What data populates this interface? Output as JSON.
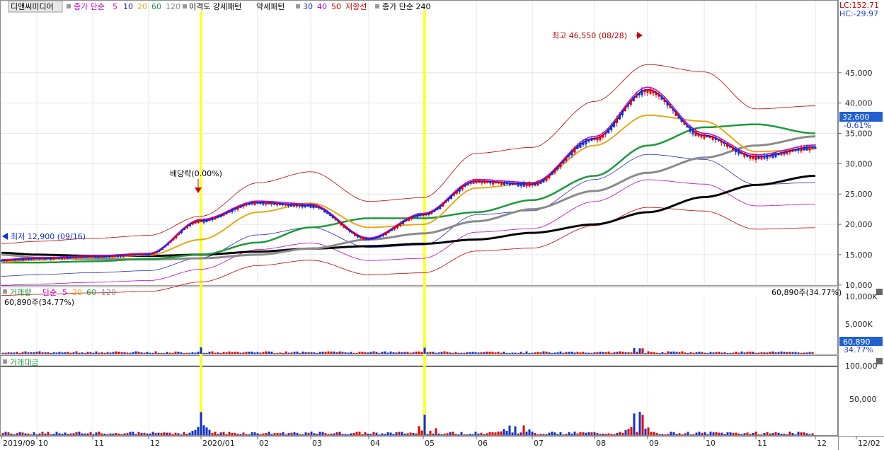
{
  "colors": {
    "ma5": "#cc00cc",
    "ma10": "#1a1aa8",
    "ma20": "#e6a817",
    "ma60": "#1a9a3a",
    "ma120": "#8a8a8a",
    "ma240": "#000000",
    "envelope": "#c00000",
    "weak": "#c000c0",
    "strong": "#2030c0",
    "up": "#e00000",
    "down": "#1030d0",
    "marker": "#ffff33",
    "highlight": "#2060d0"
  },
  "header": {
    "stock_name": "디앤씨미디어",
    "price_ma_label": "종가 단순",
    "price_ma_periods": [
      "5",
      "10",
      "20",
      "60",
      "120"
    ],
    "divergence_label": "이격도 강세패턴",
    "weak_label": "약세패턴",
    "weak_periods": [
      "30",
      "40",
      "50"
    ],
    "resistance_label": "저항선",
    "long_ma_label": "종가 단순 240"
  },
  "right_info": {
    "lc": "LC:152.71",
    "hc": "HC:-29.97"
  },
  "current": {
    "price": "32,600",
    "change": "-0.61%"
  },
  "annotations": {
    "high": "최고 46,550 (08/28)",
    "low": "최저 12,900 (09/16)",
    "dividend": "배당락(0.00%)"
  },
  "volume_panel": {
    "title": "거래량",
    "ma_label": "단순",
    "ma_periods": [
      "5",
      "20",
      "60",
      "120"
    ],
    "current_left": "60,890주(34.77%)",
    "current_right": "60,890주(34.77%)",
    "badge_value": "60,890",
    "badge_pct": "34.77%",
    "ticks": [
      "10,000K",
      "5,000K"
    ]
  },
  "amount_panel": {
    "title": "거래대금",
    "ticks": [
      "100,000",
      "50,000"
    ]
  },
  "price_axis_ticks": [
    "45,000",
    "40,000",
    "35,000",
    "30,000",
    "25,000",
    "20,000",
    "15,000",
    "10,000"
  ],
  "x_axis_labels": [
    "2019/09",
    "10",
    "11",
    "12",
    "2020/01",
    "02",
    "03",
    "04",
    "05",
    "06",
    "07",
    "08",
    "09",
    "10",
    "11",
    "12",
    "12/02"
  ],
  "chart_data": {
    "type": "line",
    "x": [
      "2019/09",
      "10",
      "11",
      "12",
      "2020/01",
      "02",
      "03",
      "04",
      "05",
      "06",
      "07",
      "08",
      "09",
      "10",
      "11",
      "12"
    ],
    "series": [
      {
        "name": "종가",
        "values": [
          14000,
          14300,
          14600,
          15000,
          20500,
          23500,
          23000,
          17500,
          21500,
          27000,
          26500,
          34000,
          42000,
          34500,
          31000,
          32600
        ]
      },
      {
        "name": "20",
        "values": [
          13800,
          14100,
          14500,
          14900,
          17500,
          22000,
          23500,
          19500,
          20000,
          26000,
          26800,
          33000,
          38000,
          37000,
          32000,
          32400
        ]
      },
      {
        "name": "60",
        "values": [
          13700,
          13700,
          13900,
          14300,
          15000,
          17000,
          19500,
          21000,
          21000,
          22000,
          24000,
          28000,
          33000,
          36000,
          36500,
          35000
        ]
      },
      {
        "name": "120",
        "values": [
          15000,
          14500,
          14300,
          14200,
          14400,
          15000,
          16000,
          17500,
          18500,
          20500,
          22500,
          25500,
          28500,
          31000,
          33000,
          34500
        ]
      },
      {
        "name": "240",
        "values": [
          15300,
          15000,
          14800,
          14800,
          15000,
          15500,
          16000,
          16400,
          16800,
          17500,
          18600,
          20000,
          22000,
          24500,
          26500,
          28000
        ]
      }
    ],
    "high": {
      "value": 46550,
      "date": "08/28"
    },
    "low": {
      "value": 12900,
      "date": "09/16"
    },
    "ylim": [
      6000,
      50000
    ],
    "grid": true
  }
}
